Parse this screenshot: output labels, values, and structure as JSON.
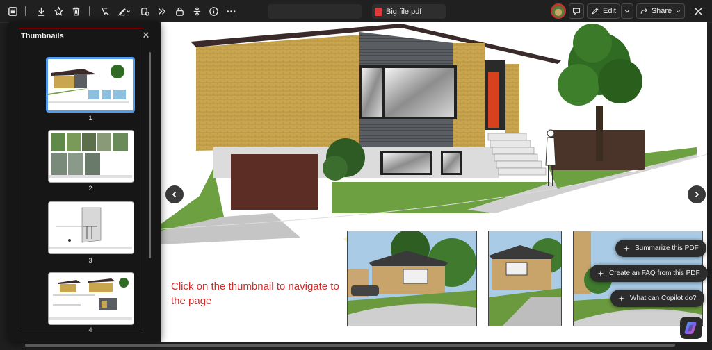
{
  "toolbar": {
    "file_title": "Big file.pdf",
    "edit_label": "Edit",
    "share_label": "Share",
    "icons": [
      "list-icon",
      "download-icon",
      "star-icon",
      "trash-icon",
      "highlight-icon",
      "draw-icon",
      "shape-icon",
      "read-aloud-icon",
      "lock-icon",
      "fit-icon",
      "info-icon",
      "more-icon"
    ]
  },
  "thumbnails": {
    "title": "Thumbnails",
    "pages": [
      "1",
      "2",
      "3",
      "4"
    ]
  },
  "annotation": {
    "text": "Click on the thumbnail to navigate to the page"
  },
  "copilot": {
    "suggestions": [
      "Summarize this PDF",
      "Create an FAQ from this PDF",
      "What can Copilot do?"
    ]
  },
  "colors": {
    "accent": "#4e9bf0",
    "annotation_red": "#d42a2a",
    "panel_bg": "#161616"
  }
}
